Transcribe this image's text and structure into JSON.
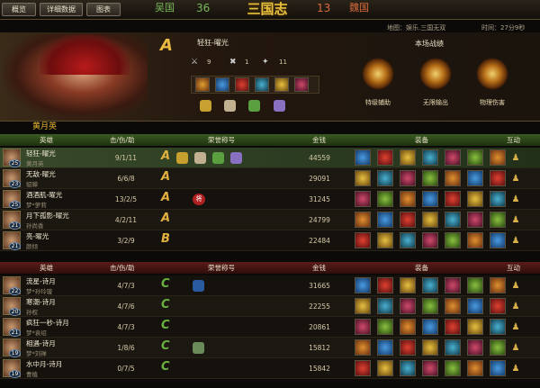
{
  "tabs": [
    "概览",
    "详细数据",
    "图表"
  ],
  "score": {
    "left_team": "吴国",
    "left_score": "36",
    "right_score": "13",
    "right_team": "魏国"
  },
  "logo": "三国志",
  "mapinfo": {
    "map": "地图：娱乐.三国无双",
    "time": "时间：27分9秒"
  },
  "hero": {
    "rank": "A",
    "name": "轻狂-曜光",
    "stat1": "9",
    "stat2": "1",
    "stat3": "11",
    "record_title": "本场战绩",
    "badges": [
      "特级辅助",
      "无限输出",
      "物理伤害"
    ]
  },
  "section_title": "黄月英",
  "headers": {
    "hero": "英雄",
    "kda": "击/伤/助",
    "honor": "荣誉称号",
    "money": "金钱",
    "equip": "装备",
    "interact": "互动"
  },
  "team1": [
    {
      "name": "轻狂-曜光",
      "sub": "黄月英",
      "level": "25",
      "kda": "9/1/11",
      "rank": "A",
      "money": "44559"
    },
    {
      "name": "无敌-曜光",
      "sub": "貂蝉",
      "level": "23",
      "kda": "6/6/8",
      "rank": "A",
      "money": "29091"
    },
    {
      "name": "酒酒肌-曜光",
      "sub": "梦*萝莉",
      "level": "25",
      "kda": "13/2/5",
      "rank": "A",
      "money": "31245"
    },
    {
      "name": "月下孤影-曜光",
      "sub": "孙尚香",
      "level": "21",
      "kda": "4/2/11",
      "rank": "A",
      "money": "24799"
    },
    {
      "name": "亮-曜光",
      "sub": "颜倾",
      "level": "21",
      "kda": "3/2/9",
      "rank": "B",
      "money": "22484"
    }
  ],
  "team2": [
    {
      "name": "流星-诗月",
      "sub": "梦*孙玲璇",
      "level": "22",
      "kda": "4/7/3",
      "rank": "C",
      "money": "31665"
    },
    {
      "name": "寒潮-诗月",
      "sub": "孙权",
      "level": "20",
      "kda": "4/7/6",
      "rank": "C",
      "money": "22255"
    },
    {
      "name": "疯狂一秒-诗月",
      "sub": "梦*袁绍",
      "level": "21",
      "kda": "4/7/3",
      "rank": "C",
      "money": "20861"
    },
    {
      "name": "相遇-诗月",
      "sub": "梦*刘禅",
      "level": "19",
      "kda": "1/8/6",
      "rank": "C",
      "money": "15812"
    },
    {
      "name": "水中月-诗月",
      "sub": "曹植",
      "level": "19",
      "kda": "0/7/5",
      "rank": "C",
      "money": "15842"
    }
  ],
  "row1_honor": "将"
}
